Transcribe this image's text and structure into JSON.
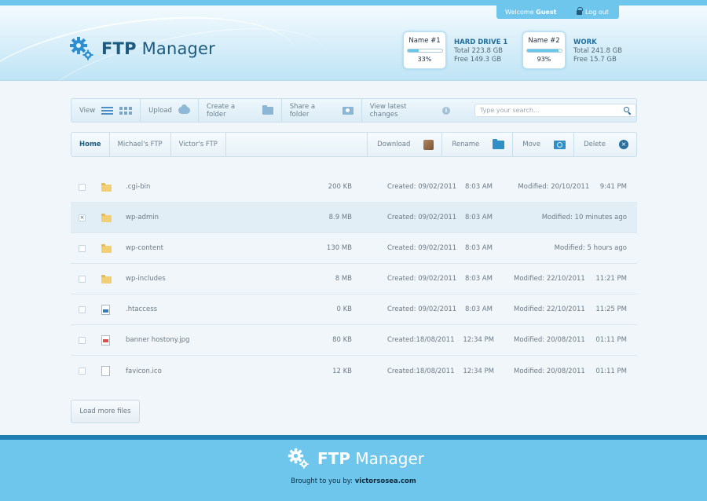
{
  "header": {
    "welcome_prefix": "Welcome",
    "welcome_user": "Guest",
    "logout_label": "Log out",
    "logo_bold": "FTP",
    "logo_rest": "Manager",
    "drives": [
      {
        "gauge_name": "Name #1",
        "percent_label": "33%",
        "used_fraction": 0.33,
        "title": "HARD DRIVE 1",
        "total": "Total 223.8 GB",
        "free": "Free 149.3 GB"
      },
      {
        "gauge_name": "Name #2",
        "percent_label": "93%",
        "used_fraction": 0.93,
        "title": "WORK",
        "total": "Total 241.8 GB",
        "free": "Free 15.7 GB"
      }
    ]
  },
  "toolbar": {
    "view_label": "View",
    "upload_label": "Upload",
    "create_folder_label": "Create a folder",
    "share_folder_label": "Share a folder",
    "latest_changes_label": "View latest changes",
    "search_placeholder": "Type your search..."
  },
  "nav": {
    "tabs": [
      "Home",
      "Michael's FTP",
      "Victor's FTP"
    ],
    "download_label": "Download",
    "rename_label": "Rename",
    "move_label": "Move",
    "delete_label": "Delete"
  },
  "files": [
    {
      "name": ".cgi-bin",
      "type": "folder",
      "size": "200 KB",
      "created": "Created: 09/02/2011",
      "created_time": "8:03 AM",
      "modified": "Modified: 20/10/2011",
      "modified_time": "9:41 PM",
      "checked": false
    },
    {
      "name": "wp-admin",
      "type": "folder",
      "size": "8.9 MB",
      "created": "Created: 09/02/2011",
      "created_time": "8:03 AM",
      "modified": "Modified: 10 minutes ago",
      "modified_time": "",
      "checked": true
    },
    {
      "name": "wp-content",
      "type": "folder",
      "size": "130 MB",
      "created": "Created: 09/02/2011",
      "created_time": "8:03 AM",
      "modified": "Modified: 5 hours ago",
      "modified_time": "",
      "checked": false
    },
    {
      "name": "wp-includes",
      "type": "folder",
      "size": "8 MB",
      "created": "Created: 09/02/2011",
      "created_time": "8:03 AM",
      "modified": "Modified: 22/10/2011",
      "modified_time": "11:21 PM",
      "checked": false
    },
    {
      "name": ".htaccess",
      "type": "code",
      "size": "0 KB",
      "created": "Created: 09/02/2011",
      "created_time": "8:03 AM",
      "modified": "Modified: 22/10/2011",
      "modified_time": "11:25 PM",
      "checked": false
    },
    {
      "name": "banner hostony.jpg",
      "type": "image",
      "size": "80 KB",
      "created": "Created:18/08/2011",
      "created_time": "12:34 PM",
      "modified": "Modified: 20/08/2011",
      "modified_time": "01:11 PM",
      "checked": false
    },
    {
      "name": "favicon.ico",
      "type": "file",
      "size": "12 KB",
      "created": "Created:18/08/2011",
      "created_time": "12:34 PM",
      "modified": "Modified: 20/08/2011",
      "modified_time": "01:11 PM",
      "checked": false
    }
  ],
  "load_more_label": "Load more files",
  "footer": {
    "logo_bold": "FTP",
    "logo_rest": "Manager",
    "credit_prefix": "Brought to you by:",
    "credit_site": "victorsosea.com"
  },
  "colors": {
    "accent": "#6fc6ec",
    "brand_dark": "#1c5b80",
    "footer_line": "#1f7eb2"
  }
}
